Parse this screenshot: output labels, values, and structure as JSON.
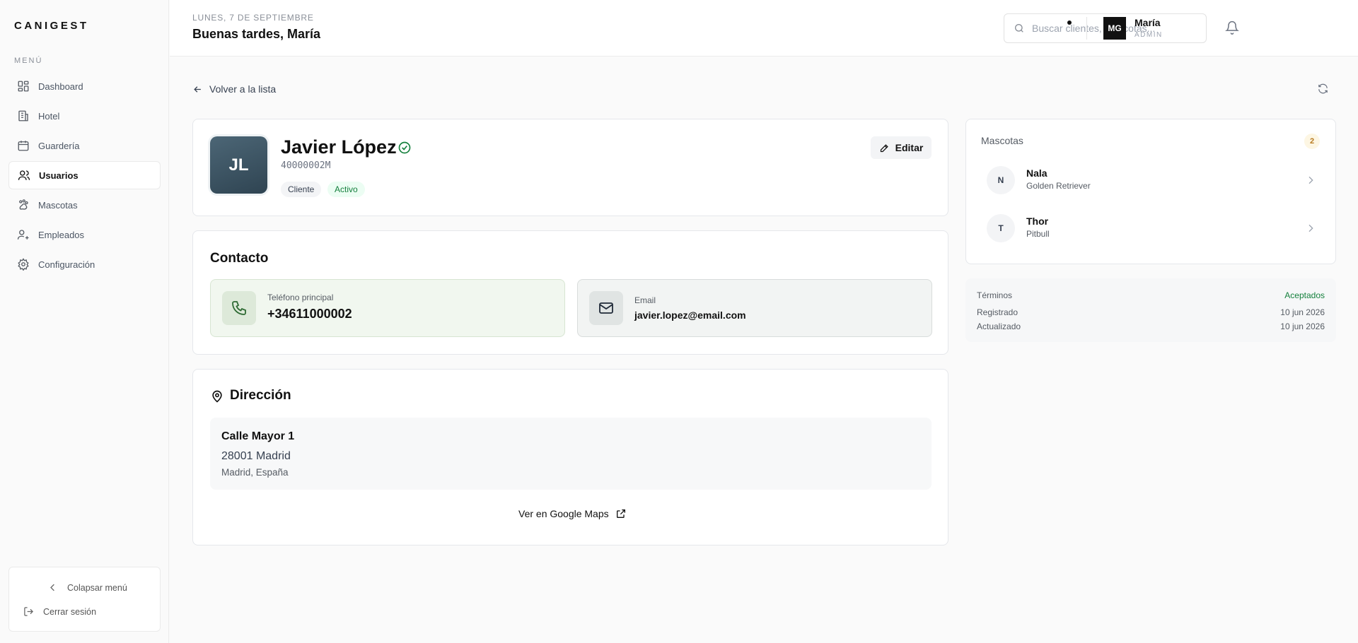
{
  "app": {
    "brand": "CANIGEST",
    "menu_label": "MENÚ"
  },
  "sidebar": {
    "items": [
      {
        "label": "Dashboard",
        "icon": "dashboard-icon"
      },
      {
        "label": "Hotel",
        "icon": "hotel-icon"
      },
      {
        "label": "Guardería",
        "icon": "calendar-icon"
      },
      {
        "label": "Usuarios",
        "icon": "users-icon",
        "active": true
      },
      {
        "label": "Mascotas",
        "icon": "paw-icon"
      },
      {
        "label": "Empleados",
        "icon": "employees-icon"
      },
      {
        "label": "Configuración",
        "icon": "gear-icon"
      }
    ],
    "collapse_label": "Colapsar menú",
    "logout_label": "Cerrar sesión"
  },
  "header": {
    "date": "LUNES, 7 DE SEPTIEMBRE",
    "greeting": "Buenas tardes, María",
    "search_placeholder": "Buscar clientes, mascotas...",
    "user": {
      "initials": "MG",
      "name": "María",
      "role": "ADMIN"
    }
  },
  "nav": {
    "back_label": "Volver a la lista"
  },
  "profile": {
    "initials": "JL",
    "name": "Javier López",
    "id": "40000002M",
    "badges": [
      "Cliente",
      "Activo"
    ],
    "edit_label": "Editar"
  },
  "contact": {
    "title": "Contacto",
    "phone_label": "Teléfono principal",
    "phone": "+34611000002",
    "email_label": "Email",
    "email": "javier.lopez@email.com"
  },
  "address": {
    "title": "Dirección",
    "line1": "Calle Mayor 1",
    "line2": "28001 Madrid",
    "line3": "Madrid, España",
    "maps_label": "Ver en Google Maps"
  },
  "pets": {
    "title": "Mascotas",
    "count": "2",
    "items": [
      {
        "initial": "N",
        "name": "Nala",
        "breed": "Golden Retriever"
      },
      {
        "initial": "T",
        "name": "Thor",
        "breed": "Pitbull"
      }
    ]
  },
  "meta": {
    "terms_label": "Términos",
    "terms_value": "Aceptados",
    "registered_label": "Registrado",
    "registered_value": "10 jun 2026",
    "updated_label": "Actualizado",
    "updated_value": "10 jun 2026"
  },
  "colors": {
    "accent_green": "#15803d",
    "avatar": "#3d5563",
    "badge_amber": "#b7791f"
  }
}
